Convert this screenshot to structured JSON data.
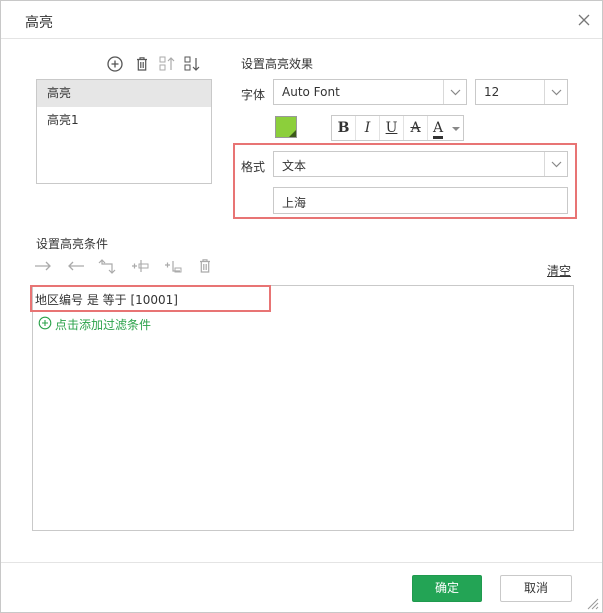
{
  "dialog": {
    "title": "高亮"
  },
  "highlight_list": {
    "items": [
      {
        "label": "高亮",
        "selected": true
      },
      {
        "label": "高亮1",
        "selected": false
      }
    ]
  },
  "toolbar_icons": [
    "add-circle-icon",
    "trash-icon",
    "move-up-icon",
    "sort-down-icon"
  ],
  "effect": {
    "section_label": "设置高亮效果",
    "font_label": "字体",
    "font_value": "Auto Font",
    "size_value": "12",
    "color": "#8ccf3b",
    "format_buttons": [
      "B",
      "I",
      "U",
      "A",
      "A"
    ],
    "format_label": "格式",
    "format_value": "文本",
    "text_value": "上海"
  },
  "conditions": {
    "section_label": "设置高亮条件",
    "clear_label": "清空",
    "condition_text": "地区编号 是 等于 [10001]",
    "add_filter_label": "点击添加过滤条件",
    "accent_color": "#2ba24a"
  },
  "footer": {
    "ok_label": "确定",
    "cancel_label": "取消",
    "ok_color": "#23a455"
  },
  "annotation_color": "#e87474"
}
